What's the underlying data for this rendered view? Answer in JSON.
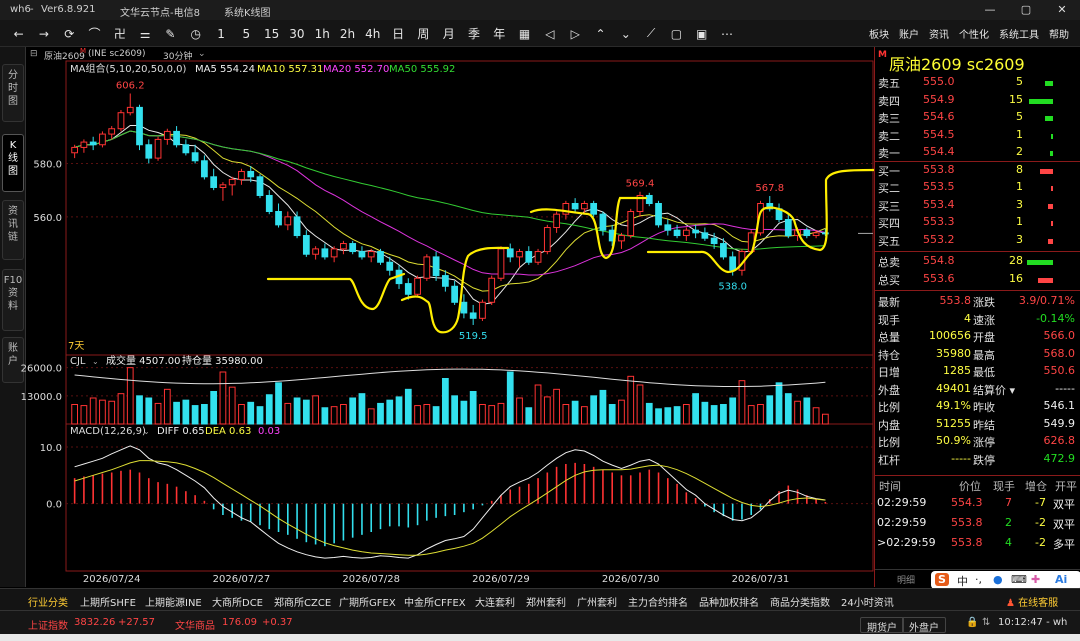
{
  "window": {
    "app": "wh6",
    "version": "Ver6.8.921",
    "node": "文华云节点-电信8",
    "system": "系统K线图",
    "controls": [
      "—",
      "▢",
      "✕"
    ]
  },
  "toolbar": {
    "icons": [
      "back-arrow",
      "forward-arrow",
      "refresh",
      "line-chart",
      "kline",
      "step",
      "draw",
      "clock",
      "1min",
      "5min",
      "15min",
      "30min",
      "1hour",
      "2hour",
      "4hour",
      "day",
      "week",
      "month",
      "season",
      "year",
      "calendar",
      "scroll-left",
      "scroll-right",
      "zoom-in",
      "zoom-out",
      "cross",
      "rect",
      "layout",
      "more"
    ],
    "icon_glyphs": [
      "←",
      "→",
      "⟳",
      "⌒",
      "卍",
      "⚌",
      "✎",
      "◷",
      "1",
      "5",
      "15",
      "30",
      "1h",
      "2h",
      "4h",
      "日",
      "周",
      "月",
      "季",
      "年",
      "▦",
      "◁",
      "▷",
      "⌃",
      "⌄",
      "⟋",
      "▢",
      "▣",
      "⋯"
    ],
    "menu": [
      "板块",
      "账户",
      "资讯",
      "个性化",
      "系统工具",
      "帮助"
    ]
  },
  "sidetabs": [
    {
      "label": "分\n时\n图",
      "active": false
    },
    {
      "label": "K\n线\n图",
      "active": true
    },
    {
      "label": "资\n讯\n链",
      "active": false
    },
    {
      "label": "F10\n资\n料",
      "active": false
    },
    {
      "label": "账\n户",
      "active": false
    }
  ],
  "chart_header": {
    "symbol": "原油2609",
    "code": "(INE sc2609)",
    "period": "30分钟",
    "ma_label": "MA组合(5,10,20,50,0,0)",
    "ma5": "MA5 554.24",
    "ma10": "MA10 557.31",
    "ma20": "MA20 552.70",
    "ma50": "MA50 555.92",
    "days": "7天"
  },
  "volume_header": {
    "label": "CJL",
    "vol": "成交量 4507.00",
    "oi": "持仓量 35980.00"
  },
  "macd_header": {
    "label": "MACD(12,26,9)",
    "diff": "DIFF 0.65",
    "dea": "DEA 0.63",
    "macd": "0.03"
  },
  "chart_data": [
    {
      "type": "candlestick",
      "title": "原油2609 30分钟",
      "y_ticks": [
        "580.0",
        "560.0"
      ],
      "x_ticks": [
        "2026/07/24",
        "2026/07/27",
        "2026/07/28",
        "2026/07/29",
        "2026/07/30",
        "2026/07/31"
      ],
      "annotations": [
        {
          "label": "606.2",
          "color": "#ff4545"
        },
        {
          "label": "519.5",
          "color": "#33ddee"
        },
        {
          "label": "569.4",
          "color": "#ff4545"
        },
        {
          "label": "567.8",
          "color": "#ff4545"
        },
        {
          "label": "538.0",
          "color": "#33ddee"
        }
      ],
      "ylim": [
        512,
        615
      ],
      "candles": [
        [
          584,
          587,
          582,
          586
        ],
        [
          586,
          589,
          584,
          588
        ],
        [
          588,
          590,
          585,
          587
        ],
        [
          587,
          592,
          586,
          591
        ],
        [
          591,
          594,
          589,
          593
        ],
        [
          593,
          600,
          592,
          599
        ],
        [
          599,
          606.2,
          598,
          601
        ],
        [
          601,
          602,
          585,
          587
        ],
        [
          587,
          589,
          580,
          582
        ],
        [
          582,
          590,
          581,
          589
        ],
        [
          589,
          593,
          587,
          592
        ],
        [
          592,
          594,
          586,
          587
        ],
        [
          587,
          589,
          583,
          584
        ],
        [
          584,
          587,
          580,
          581
        ],
        [
          581,
          583,
          574,
          575
        ],
        [
          575,
          578,
          570,
          571
        ],
        [
          571,
          573,
          566,
          572
        ],
        [
          572,
          575,
          568,
          574
        ],
        [
          574,
          578,
          572,
          577
        ],
        [
          577,
          579,
          573,
          575
        ],
        [
          575,
          576,
          567,
          568
        ],
        [
          568,
          570,
          561,
          562
        ],
        [
          562,
          565,
          556,
          557
        ],
        [
          557,
          562,
          555,
          560
        ],
        [
          560,
          562,
          552,
          553
        ],
        [
          553,
          555,
          545,
          546
        ],
        [
          546,
          549,
          544,
          548
        ],
        [
          548,
          550,
          544,
          545
        ],
        [
          545,
          549,
          543,
          548
        ],
        [
          548,
          551,
          546,
          550
        ],
        [
          550,
          551,
          546,
          547
        ],
        [
          547,
          549,
          544,
          545
        ],
        [
          545,
          548,
          543,
          547
        ],
        [
          547,
          548,
          542,
          543
        ],
        [
          543,
          545,
          538,
          540
        ],
        [
          540,
          542,
          533,
          535
        ],
        [
          535,
          537,
          529,
          531
        ],
        [
          531,
          538,
          530,
          537
        ],
        [
          537,
          546,
          536,
          545
        ],
        [
          545,
          547,
          536,
          538
        ],
        [
          538,
          540,
          532,
          534
        ],
        [
          534,
          536,
          527,
          528
        ],
        [
          528,
          531,
          522,
          524
        ],
        [
          524,
          527,
          519.5,
          522
        ],
        [
          522,
          529,
          521,
          528
        ],
        [
          528,
          538,
          527,
          537
        ],
        [
          537,
          549,
          536,
          548
        ],
        [
          548,
          550,
          543,
          545
        ],
        [
          545,
          548,
          541,
          547
        ],
        [
          547,
          549,
          542,
          543
        ],
        [
          543,
          548,
          542,
          547
        ],
        [
          547,
          557,
          546,
          556
        ],
        [
          556,
          562,
          554,
          561
        ],
        [
          561,
          566,
          559,
          565
        ],
        [
          565,
          567,
          562,
          563
        ],
        [
          563,
          566,
          561,
          565
        ],
        [
          565,
          566,
          560,
          561
        ],
        [
          561,
          562,
          553,
          555
        ],
        [
          555,
          557,
          549,
          551
        ],
        [
          551,
          554,
          548,
          553
        ],
        [
          553,
          563,
          552,
          562
        ],
        [
          562,
          569.4,
          560,
          568
        ],
        [
          568,
          569,
          564,
          565
        ],
        [
          565,
          566,
          556,
          557
        ],
        [
          557,
          559,
          553,
          555
        ],
        [
          555,
          557,
          552,
          553
        ],
        [
          553,
          556,
          551,
          555
        ],
        [
          555,
          557,
          552,
          554
        ],
        [
          554,
          556,
          551,
          552
        ],
        [
          552,
          554,
          548,
          550
        ],
        [
          550,
          552,
          544,
          545
        ],
        [
          545,
          547,
          538,
          540
        ],
        [
          540,
          548,
          538,
          547
        ],
        [
          547,
          555,
          546,
          554
        ],
        [
          554,
          566,
          553,
          565
        ],
        [
          565,
          567.8,
          562,
          563
        ],
        [
          563,
          565,
          558,
          559
        ],
        [
          559,
          561,
          552,
          553
        ],
        [
          553,
          556,
          551,
          555
        ],
        [
          555,
          556,
          552,
          553
        ],
        [
          553,
          555,
          552,
          554
        ],
        [
          554,
          555.5,
          552.8,
          553.8
        ]
      ]
    },
    {
      "type": "bar",
      "title": "CJL",
      "y_ticks": [
        "26000.0",
        "13000.0"
      ],
      "ylim": [
        0,
        30000
      ],
      "values": [
        9000,
        8500,
        12000,
        11000,
        10500,
        14000,
        26000,
        13000,
        12000,
        9500,
        16000,
        10000,
        11000,
        8500,
        9000,
        15000,
        24000,
        17000,
        9000,
        10000,
        8000,
        13500,
        19000,
        9500,
        12000,
        11000,
        13000,
        7500,
        8000,
        9000,
        12000,
        14000,
        7000,
        9500,
        11000,
        12500,
        16000,
        8500,
        9000,
        8000,
        21000,
        13000,
        10500,
        15000,
        9000,
        8500,
        9500,
        24000,
        12000,
        7500,
        18000,
        12500,
        16000,
        9000,
        10500,
        8000,
        13000,
        15500,
        9000,
        11000,
        22000,
        18000,
        9500,
        7000,
        7500,
        8000,
        9000,
        14000,
        10000,
        8500,
        9000,
        12000,
        20000,
        8500,
        9000,
        13000,
        19000,
        14000,
        10500,
        12000,
        7500,
        4507
      ],
      "direction": [
        1,
        1,
        1,
        1,
        1,
        1,
        1,
        0,
        0,
        1,
        1,
        0,
        0,
        0,
        0,
        0,
        1,
        1,
        1,
        0,
        0,
        0,
        0,
        1,
        0,
        0,
        1,
        0,
        1,
        1,
        0,
        0,
        1,
        0,
        0,
        0,
        0,
        1,
        1,
        0,
        0,
        0,
        0,
        0,
        1,
        1,
        1,
        0,
        1,
        0,
        1,
        1,
        1,
        1,
        0,
        1,
        0,
        0,
        0,
        1,
        1,
        1,
        0,
        0,
        0,
        0,
        1,
        0,
        0,
        0,
        0,
        0,
        1,
        1,
        1,
        0,
        0,
        0,
        1,
        0,
        1,
        1
      ],
      "ma_label": "MA"
    },
    {
      "type": "bar",
      "title": "MACD(12,26,9)",
      "y_ticks": [
        "10.0",
        "0.0"
      ],
      "ylim": [
        -11,
        13
      ],
      "values": [
        4.5,
        4.8,
        5.0,
        5.3,
        5.5,
        5.8,
        6.0,
        5.5,
        4.5,
        3.8,
        3.5,
        3.0,
        2.2,
        1.5,
        0.5,
        -1.0,
        -2.0,
        -2.5,
        -3.0,
        -3.2,
        -3.8,
        -4.5,
        -5.0,
        -5.5,
        -6.2,
        -6.8,
        -7.2,
        -7.5,
        -7.0,
        -6.5,
        -6.0,
        -5.5,
        -5.0,
        -4.5,
        -4.0,
        -4.0,
        -4.2,
        -3.8,
        -3.0,
        -2.5,
        -2.2,
        -2.0,
        -1.5,
        -1.0,
        -0.3,
        0.5,
        1.5,
        2.5,
        3.0,
        3.5,
        4.5,
        5.5,
        6.5,
        7.0,
        7.2,
        7.0,
        6.5,
        6.0,
        5.5,
        5.0,
        5.0,
        5.5,
        6.0,
        5.5,
        4.5,
        3.5,
        2.0,
        1.0,
        -0.5,
        -1.5,
        -2.2,
        -3.0,
        -2.8,
        -2.0,
        -1.0,
        0.8,
        2.2,
        3.2,
        2.5,
        1.5,
        0.8,
        0.3
      ],
      "diff": [
        6.5,
        7.0,
        7.5,
        8.0,
        8.8,
        9.5,
        10.2,
        9.5,
        8.0,
        7.2,
        6.8,
        6.0,
        5.0,
        4.0,
        2.8,
        1.0,
        -0.5,
        -1.5,
        -2.5,
        -3.2,
        -4.5,
        -5.8,
        -7.0,
        -7.8,
        -8.5,
        -9.0,
        -9.4,
        -9.6,
        -9.5,
        -9.3,
        -9.5,
        -9.6,
        -9.5,
        -9.2,
        -9.3,
        -9.5,
        -9.6,
        -9.0,
        -8.0,
        -7.2,
        -6.5,
        -6.2,
        -5.8,
        -4.5,
        -2.5,
        -0.5,
        1.5,
        3.0,
        3.8,
        4.5,
        5.5,
        6.8,
        8.0,
        9.0,
        9.5,
        9.3,
        8.5,
        7.5,
        6.8,
        6.2,
        6.8,
        7.5,
        7.8,
        7.0,
        5.5,
        4.0,
        2.5,
        1.5,
        0.0,
        -1.0,
        -2.0,
        -2.8,
        -3.0,
        -2.5,
        -1.2,
        0.5,
        1.8,
        2.4,
        2.0,
        1.3,
        0.9,
        0.65
      ],
      "dea": [
        4.0,
        4.5,
        5.0,
        5.5,
        6.0,
        6.6,
        7.2,
        7.6,
        7.6,
        7.5,
        7.4,
        7.2,
        6.8,
        6.2,
        5.5,
        4.6,
        3.6,
        2.6,
        1.6,
        0.6,
        -0.4,
        -1.5,
        -2.6,
        -3.6,
        -4.5,
        -5.4,
        -6.2,
        -6.9,
        -7.4,
        -7.8,
        -8.2,
        -8.5,
        -8.7,
        -8.8,
        -8.9,
        -9.0,
        -9.1,
        -9.1,
        -8.9,
        -8.6,
        -8.2,
        -7.9,
        -7.5,
        -7.0,
        -6.1,
        -4.9,
        -3.6,
        -2.3,
        -1.2,
        -0.2,
        0.8,
        1.9,
        3.0,
        4.1,
        5.0,
        5.6,
        5.9,
        6.0,
        6.0,
        6.0,
        6.1,
        6.4,
        6.7,
        6.8,
        6.5,
        6.0,
        5.3,
        4.5,
        3.6,
        2.7,
        1.8,
        0.9,
        0.2,
        -0.3,
        -0.5,
        -0.3,
        0.1,
        0.6,
        0.9,
        1.0,
        0.8,
        0.63
      ]
    }
  ],
  "quote": {
    "badge": "M",
    "title": "原油2609  sc2609",
    "orderbook": [
      {
        "label": "卖五",
        "price": "555.0",
        "vol": "5",
        "bar": 8,
        "side": "sell"
      },
      {
        "label": "卖四",
        "price": "554.9",
        "vol": "15",
        "bar": 24,
        "side": "sell"
      },
      {
        "label": "卖三",
        "price": "554.6",
        "vol": "5",
        "bar": 8,
        "side": "sell"
      },
      {
        "label": "卖二",
        "price": "554.5",
        "vol": "1",
        "bar": 2,
        "side": "sell"
      },
      {
        "label": "卖一",
        "price": "554.4",
        "vol": "2",
        "bar": 3,
        "side": "sell"
      },
      {
        "label": "买一",
        "price": "553.8",
        "vol": "8",
        "bar": 13,
        "side": "buy"
      },
      {
        "label": "买二",
        "price": "553.5",
        "vol": "1",
        "bar": 2,
        "side": "buy"
      },
      {
        "label": "买三",
        "price": "553.4",
        "vol": "3",
        "bar": 5,
        "side": "buy"
      },
      {
        "label": "买四",
        "price": "553.3",
        "vol": "1",
        "bar": 2,
        "side": "buy"
      },
      {
        "label": "买五",
        "price": "553.2",
        "vol": "3",
        "bar": 5,
        "side": "buy"
      }
    ],
    "totals": [
      {
        "label": "总卖",
        "price": "554.8",
        "vol": "28",
        "bar": 26,
        "side": "sell"
      },
      {
        "label": "总买",
        "price": "553.6",
        "vol": "16",
        "bar": 15,
        "side": "buy"
      }
    ],
    "stats": [
      {
        "l1": "最新",
        "v1": "553.8",
        "c1": "red",
        "l2": "涨跌",
        "v2": "3.9/0.71%",
        "c2": "red"
      },
      {
        "l1": "现手",
        "v1": "4",
        "c1": "yel",
        "l2": "速涨",
        "v2": "-0.14%",
        "c2": "green"
      },
      {
        "l1": "总量",
        "v1": "100656",
        "c1": "yel",
        "l2": "开盘",
        "v2": "566.0",
        "c2": "red"
      },
      {
        "l1": "持仓",
        "v1": "35980",
        "c1": "yel",
        "l2": "最高",
        "v2": "568.0",
        "c2": "red"
      },
      {
        "l1": "日增",
        "v1": "1285",
        "c1": "yel",
        "l2": "最低",
        "v2": "550.6",
        "c2": "red"
      },
      {
        "l1": "外盘",
        "v1": "49401",
        "c1": "yel",
        "l2": "结算价 ▾",
        "v2": "-----",
        "c2": "wht"
      },
      {
        "l1": "比例",
        "v1": "49.1%",
        "c1": "yel",
        "l2": "昨收",
        "v2": "546.1",
        "c2": "wht"
      },
      {
        "l1": "内盘",
        "v1": "51255",
        "c1": "yel",
        "l2": "昨结",
        "v2": "549.9",
        "c2": "wht"
      },
      {
        "l1": "比例",
        "v1": "50.9%",
        "c1": "yel",
        "l2": "涨停",
        "v2": "626.8",
        "c2": "red"
      },
      {
        "l1": "杠杆",
        "v1": "-----",
        "c1": "yel",
        "l2": "跌停",
        "v2": "472.9",
        "c2": "green"
      }
    ],
    "ticks_header": [
      "时间",
      "价位",
      "现手",
      "增仓",
      "开平"
    ],
    "ticks": [
      {
        "time": "02:29:59",
        "price": "554.3",
        "vol": "7",
        "oi": "-7",
        "type": "双平"
      },
      {
        "time": "02:29:59",
        "price": "553.8",
        "vol": "2",
        "oi": "-2",
        "type": "双平"
      },
      {
        "time": ">02:29:59",
        "price": "553.8",
        "vol": "4",
        "oi": "-2",
        "type": "多平"
      }
    ],
    "footer_label": "明细",
    "ime": [
      "S",
      "中",
      "·,",
      "●",
      "⌨",
      "✚",
      "Ai"
    ]
  },
  "bottom_tabs": [
    "行业分类",
    "上期所SHFE",
    "上期能源INE",
    "大商所DCE",
    "郑商所CZCE",
    "广期所GFEX",
    "中金所CFFEX",
    "大连套利",
    "郑州套利",
    "广州套利",
    "主力合约排名",
    "品种加权排名",
    "商品分类指数",
    "24小时资讯"
  ],
  "online_service": "在线客服",
  "status": {
    "sh_label": "上证指数",
    "sh_value": "3832.26",
    "sh_change": "+27.57",
    "wh_label": "文华商品",
    "wh_value": "176.09",
    "wh_change": "+0.37",
    "btn1": "期货户",
    "btn2": "外盘户",
    "time": "10:12:47 - wh"
  }
}
